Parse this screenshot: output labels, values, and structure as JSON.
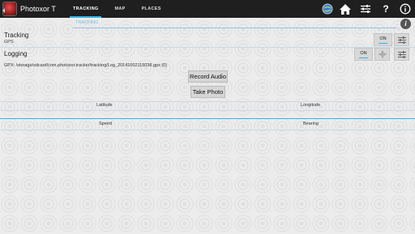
{
  "actionbar": {
    "title": "Photoxor T",
    "tabs": [
      {
        "label": "TRACKING",
        "active": true
      },
      {
        "label": "MAP",
        "active": false
      },
      {
        "label": "PLACES",
        "active": false
      }
    ],
    "icons": [
      "globe-icon",
      "home-icon",
      "settings-sliders-icon",
      "help-icon",
      "info-icon"
    ]
  },
  "section": {
    "header": "TRACKING"
  },
  "tracking": {
    "title": "Tracking",
    "subtitle": "GPS",
    "toggle": "ON"
  },
  "logging": {
    "title": "Logging",
    "toggle": "ON"
  },
  "gpx": {
    "path": "GPX: /storage/sdcard/com.photoxor.tracker/tracking/Log_20141002115038.gpx (0)"
  },
  "buttons": {
    "record_audio": "Record Audio",
    "take_photo": "Take Photo"
  },
  "fields": {
    "latitude": "Latitude",
    "longitude": "Longitude",
    "speed": "Speed",
    "bearing": "Bearing"
  },
  "colors": {
    "accent": "#33b5e5",
    "actionbar": "#1f1f1f"
  }
}
